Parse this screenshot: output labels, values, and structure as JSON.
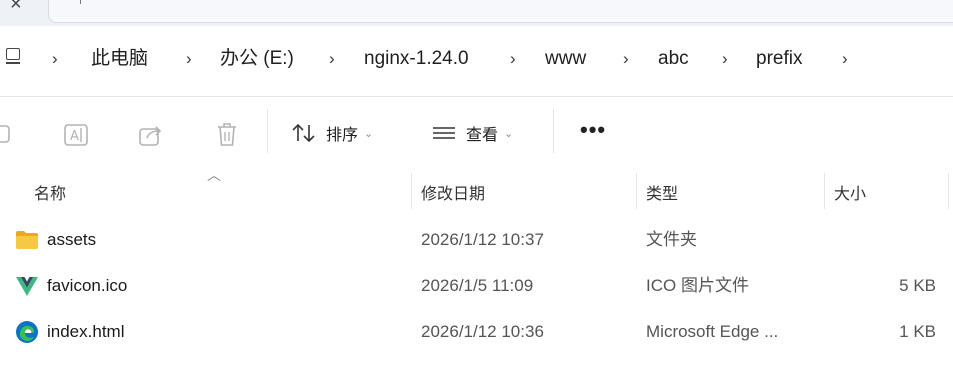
{
  "breadcrumbs": [
    "此电脑",
    "办公 (E:)",
    "nginx-1.24.0",
    "www",
    "abc",
    "prefix"
  ],
  "toolbar": {
    "sort_label": "排序",
    "view_label": "查看",
    "more_label": "•••"
  },
  "columns": {
    "name": "名称",
    "date": "修改日期",
    "type": "类型",
    "size": "大小"
  },
  "files": [
    {
      "name": "assets",
      "date": "2026/1/12 10:37",
      "type": "文件夹",
      "size": "",
      "icon": "folder-icon"
    },
    {
      "name": "favicon.ico",
      "date": "2026/1/5 11:09",
      "type": "ICO 图片文件",
      "size": "5 KB",
      "icon": "vue-logo-icon"
    },
    {
      "name": "index.html",
      "date": "2026/1/12 10:36",
      "type": "Microsoft Edge ...",
      "size": "1 KB",
      "icon": "edge-browser-icon"
    }
  ],
  "colors": {
    "folder": "#f3c242",
    "vue_green": "#41b883",
    "vue_dark": "#34495e",
    "edge_blue": "#0c73c5",
    "edge_green": "#35c05c"
  }
}
